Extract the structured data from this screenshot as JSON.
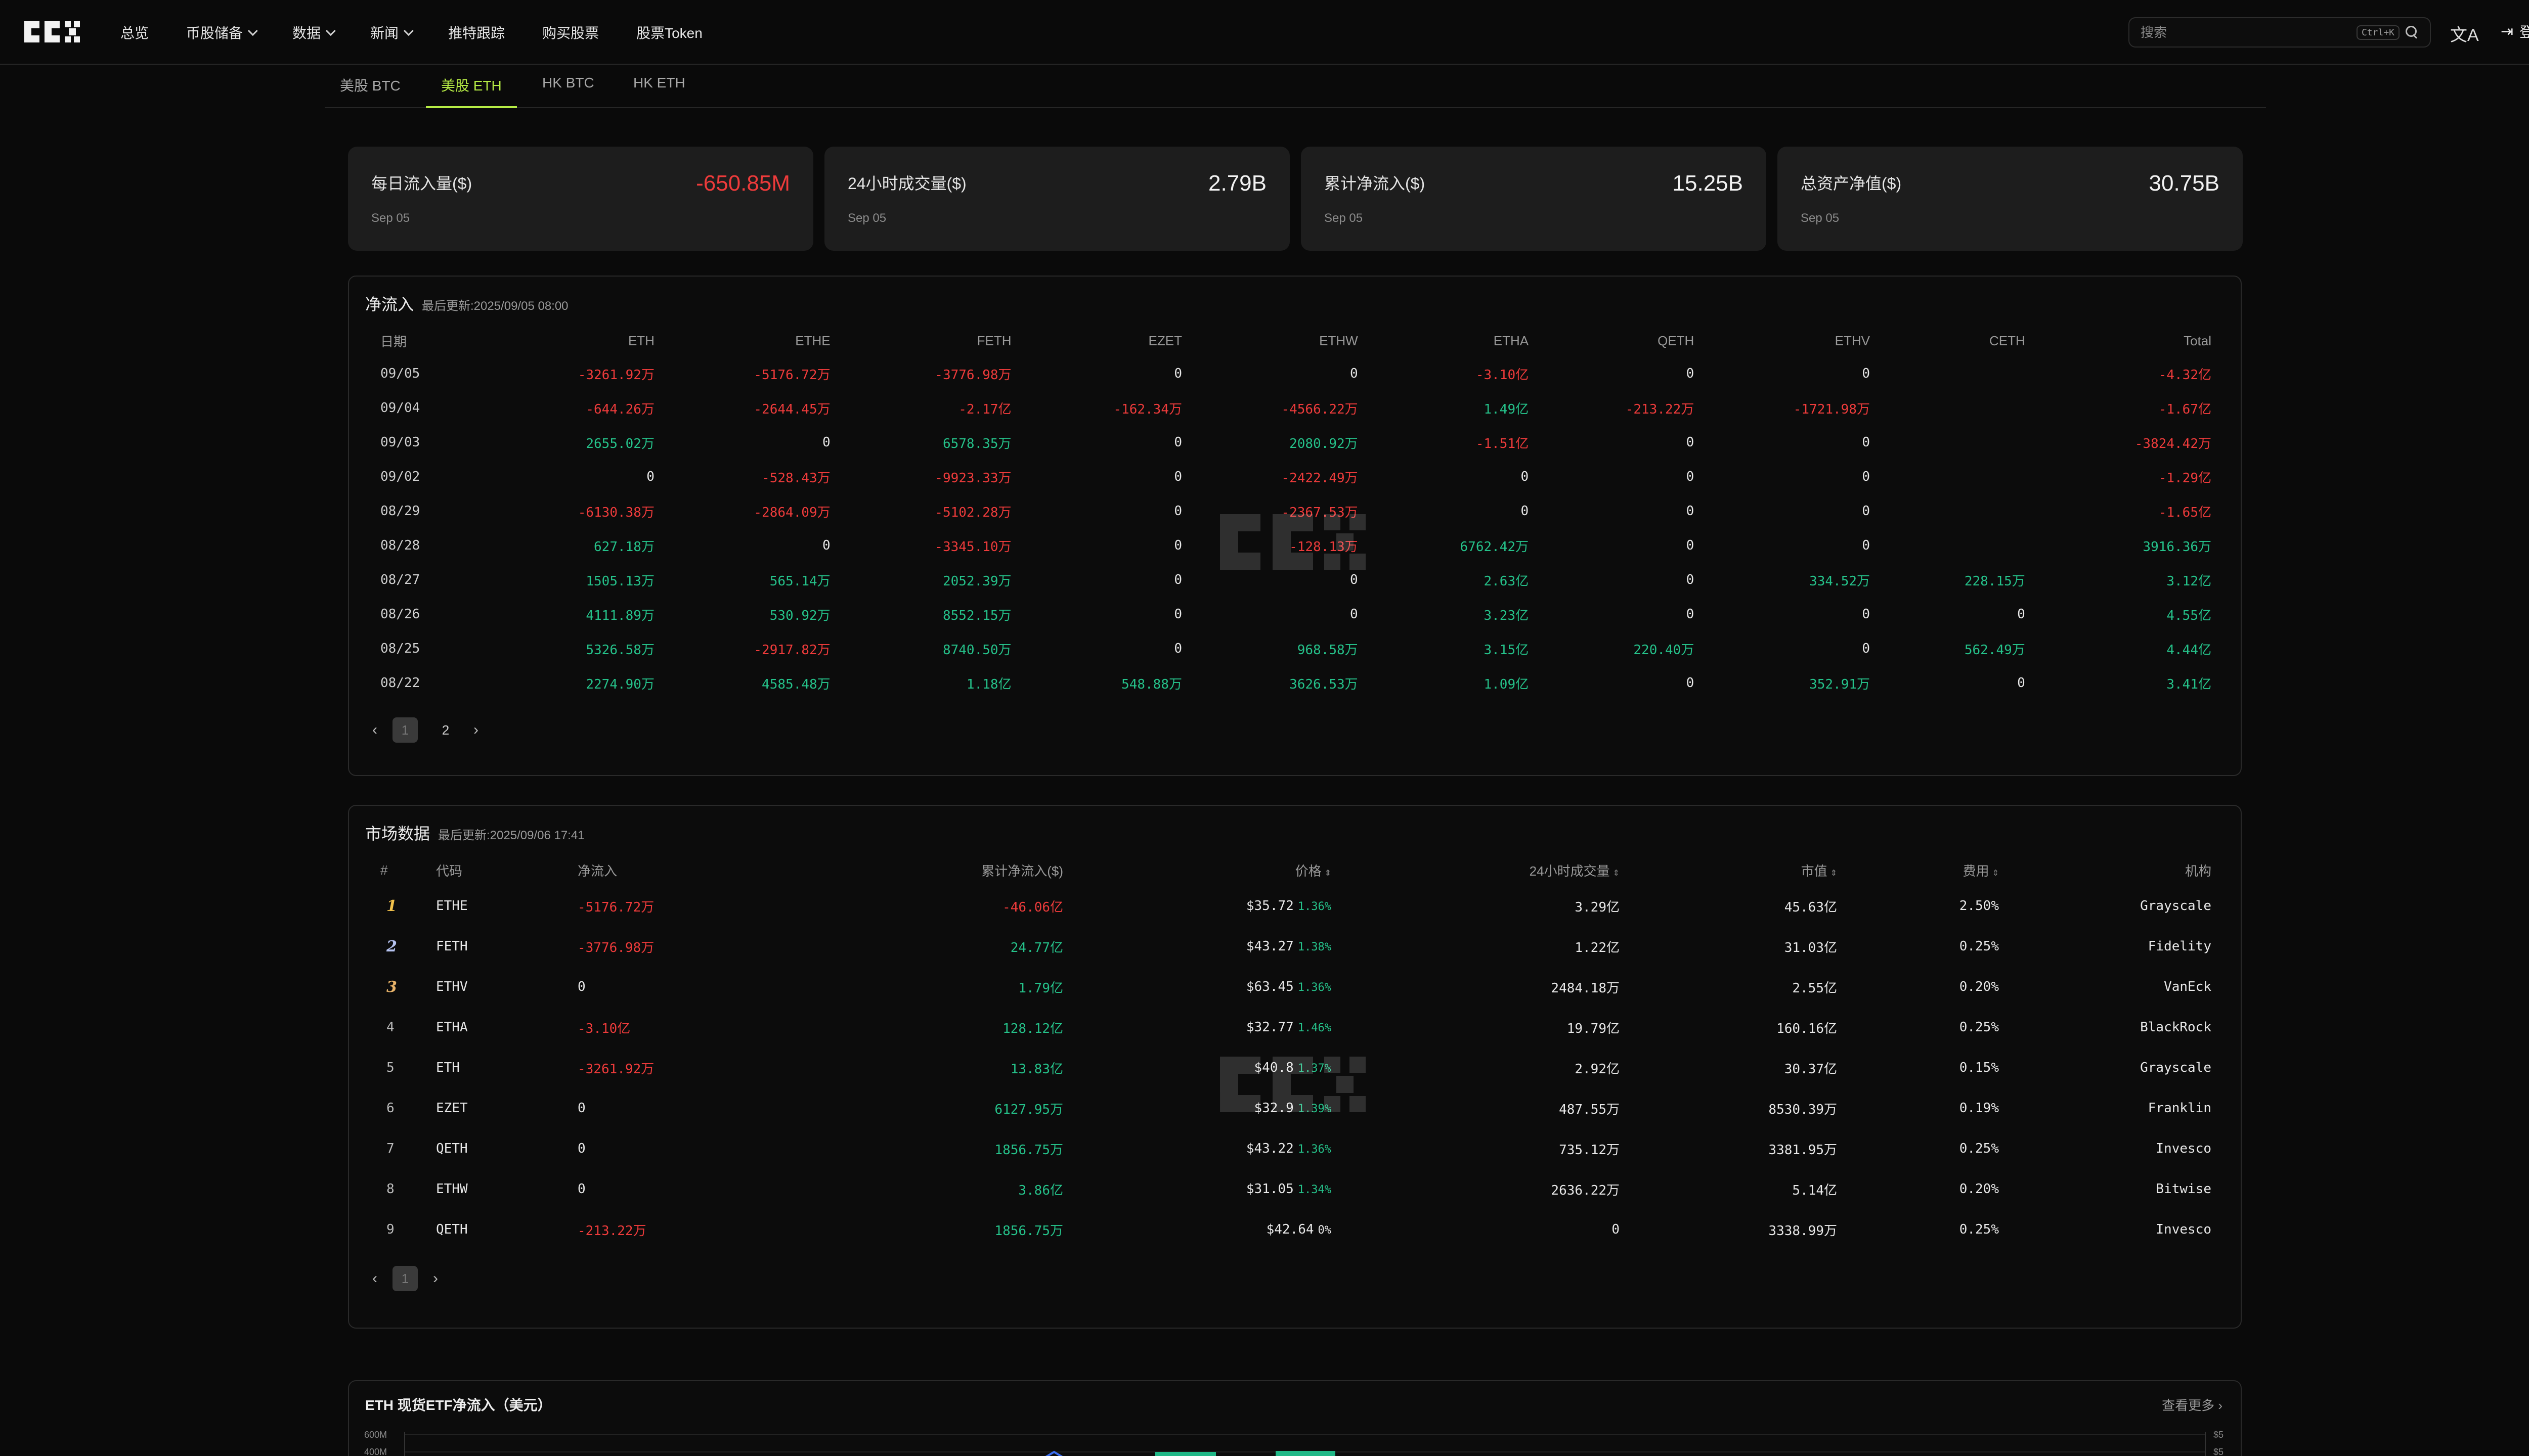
{
  "nav": {
    "items": [
      {
        "label": "总览",
        "dropdown": false
      },
      {
        "label": "币股储备",
        "dropdown": true
      },
      {
        "label": "数据",
        "dropdown": true
      },
      {
        "label": "新闻",
        "dropdown": true
      },
      {
        "label": "推特跟踪",
        "dropdown": false
      },
      {
        "label": "购买股票",
        "dropdown": false
      },
      {
        "label": "股票Token",
        "dropdown": false
      }
    ],
    "search_placeholder": "搜索",
    "search_shortcut": "Ctrl+K",
    "translate_icon": "文A",
    "login_icon": "⇥",
    "login_label": "登录"
  },
  "tabs": [
    "美股 BTC",
    "美股 ETH",
    "HK BTC",
    "HK ETH"
  ],
  "active_tab": "美股 ETH",
  "stats": [
    {
      "label": "每日流入量($)",
      "value": "-650.85M",
      "date": "Sep 05",
      "negative": true
    },
    {
      "label": "24小时成交量($)",
      "value": "2.79B",
      "date": "Sep 05",
      "negative": false
    },
    {
      "label": "累计净流入($)",
      "value": "15.25B",
      "date": "Sep 05",
      "negative": false
    },
    {
      "label": "总资产净值($)",
      "value": "30.75B",
      "date": "Sep 05",
      "negative": false
    }
  ],
  "netflow": {
    "title": "净流入",
    "updated": "最后更新:2025/09/05 08:00",
    "columns": [
      "日期",
      "ETH",
      "ETHE",
      "FETH",
      "EZET",
      "ETHW",
      "ETHA",
      "QETH",
      "ETHV",
      "CETH",
      "Total"
    ],
    "rows": [
      [
        "09/05",
        "-3261.92万",
        "-5176.72万",
        "-3776.98万",
        "0",
        "0",
        "-3.10亿",
        "0",
        "0",
        "",
        "-4.32亿"
      ],
      [
        "09/04",
        "-644.26万",
        "-2644.45万",
        "-2.17亿",
        "-162.34万",
        "-4566.22万",
        "1.49亿",
        "-213.22万",
        "-1721.98万",
        "",
        "-1.67亿"
      ],
      [
        "09/03",
        "2655.02万",
        "0",
        "6578.35万",
        "0",
        "2080.92万",
        "-1.51亿",
        "0",
        "0",
        "",
        "-3824.42万"
      ],
      [
        "09/02",
        "0",
        "-528.43万",
        "-9923.33万",
        "0",
        "-2422.49万",
        "0",
        "0",
        "0",
        "",
        "-1.29亿"
      ],
      [
        "08/29",
        "-6130.38万",
        "-2864.09万",
        "-5102.28万",
        "0",
        "-2367.53万",
        "0",
        "0",
        "0",
        "",
        "-1.65亿"
      ],
      [
        "08/28",
        "627.18万",
        "0",
        "-3345.10万",
        "0",
        "-128.13万",
        "6762.42万",
        "0",
        "0",
        "",
        "3916.36万"
      ],
      [
        "08/27",
        "1505.13万",
        "565.14万",
        "2052.39万",
        "0",
        "0",
        "2.63亿",
        "0",
        "334.52万",
        "228.15万",
        "3.12亿"
      ],
      [
        "08/26",
        "4111.89万",
        "530.92万",
        "8552.15万",
        "0",
        "0",
        "3.23亿",
        "0",
        "0",
        "0",
        "4.55亿"
      ],
      [
        "08/25",
        "5326.58万",
        "-2917.82万",
        "8740.50万",
        "0",
        "968.58万",
        "3.15亿",
        "220.40万",
        "0",
        "562.49万",
        "4.44亿"
      ],
      [
        "08/22",
        "2274.90万",
        "4585.48万",
        "1.18亿",
        "548.88万",
        "3626.53万",
        "1.09亿",
        "0",
        "352.91万",
        "0",
        "3.41亿"
      ]
    ],
    "pages": [
      "1",
      "2"
    ],
    "active_page": "1"
  },
  "market": {
    "title": "市场数据",
    "updated": "最后更新:2025/09/06 17:41",
    "columns": [
      "#",
      "代码",
      "净流入",
      "累计净流入($)",
      "价格",
      "24小时成交量",
      "市值",
      "费用",
      "机构"
    ],
    "rows": [
      {
        "rank": "1",
        "code": "ETHE",
        "netflow": "-5176.72万",
        "cum": "-46.06亿",
        "price": "$35.72",
        "pct": "1.36%",
        "vol": "3.29亿",
        "mcap": "45.63亿",
        "fee": "2.50%",
        "issuer": "Grayscale"
      },
      {
        "rank": "2",
        "code": "FETH",
        "netflow": "-3776.98万",
        "cum": "24.77亿",
        "price": "$43.27",
        "pct": "1.38%",
        "vol": "1.22亿",
        "mcap": "31.03亿",
        "fee": "0.25%",
        "issuer": "Fidelity"
      },
      {
        "rank": "3",
        "code": "ETHV",
        "netflow": "0",
        "cum": "1.79亿",
        "price": "$63.45",
        "pct": "1.36%",
        "vol": "2484.18万",
        "mcap": "2.55亿",
        "fee": "0.20%",
        "issuer": "VanEck"
      },
      {
        "rank": "4",
        "code": "ETHA",
        "netflow": "-3.10亿",
        "cum": "128.12亿",
        "price": "$32.77",
        "pct": "1.46%",
        "vol": "19.79亿",
        "mcap": "160.16亿",
        "fee": "0.25%",
        "issuer": "BlackRock"
      },
      {
        "rank": "5",
        "code": "ETH",
        "netflow": "-3261.92万",
        "cum": "13.83亿",
        "price": "$40.8",
        "pct": "1.37%",
        "vol": "2.92亿",
        "mcap": "30.37亿",
        "fee": "0.15%",
        "issuer": "Grayscale"
      },
      {
        "rank": "6",
        "code": "EZET",
        "netflow": "0",
        "cum": "6127.95万",
        "price": "$32.9",
        "pct": "1.39%",
        "vol": "487.55万",
        "mcap": "8530.39万",
        "fee": "0.19%",
        "issuer": "Franklin"
      },
      {
        "rank": "7",
        "code": "QETH",
        "netflow": "0",
        "cum": "1856.75万",
        "price": "$43.22",
        "pct": "1.36%",
        "vol": "735.12万",
        "mcap": "3381.95万",
        "fee": "0.25%",
        "issuer": "Invesco"
      },
      {
        "rank": "8",
        "code": "ETHW",
        "netflow": "0",
        "cum": "3.86亿",
        "price": "$31.05",
        "pct": "1.34%",
        "vol": "2636.22万",
        "mcap": "5.14亿",
        "fee": "0.20%",
        "issuer": "Bitwise"
      },
      {
        "rank": "9",
        "code": "QETH",
        "netflow": "-213.22万",
        "cum": "1856.75万",
        "price": "$42.64",
        "pct": "0%",
        "vol": "0",
        "mcap": "3338.99万",
        "fee": "0.25%",
        "issuer": "Invesco"
      }
    ],
    "pages": [
      "1"
    ],
    "active_page": "1"
  },
  "chart_section": {
    "title": "ETH 现货ETF净流入（美元）",
    "more_label": "查看更多",
    "y_ticks_left": [
      "600M",
      "400M"
    ],
    "y_ticks_right": [
      "$5",
      "$5"
    ]
  },
  "colors": {
    "negative": "#ee3b3b",
    "positive": "#25c28a",
    "accent": "#b6ec45",
    "background": "#0a0a0a",
    "card": "#1d1d1d"
  }
}
